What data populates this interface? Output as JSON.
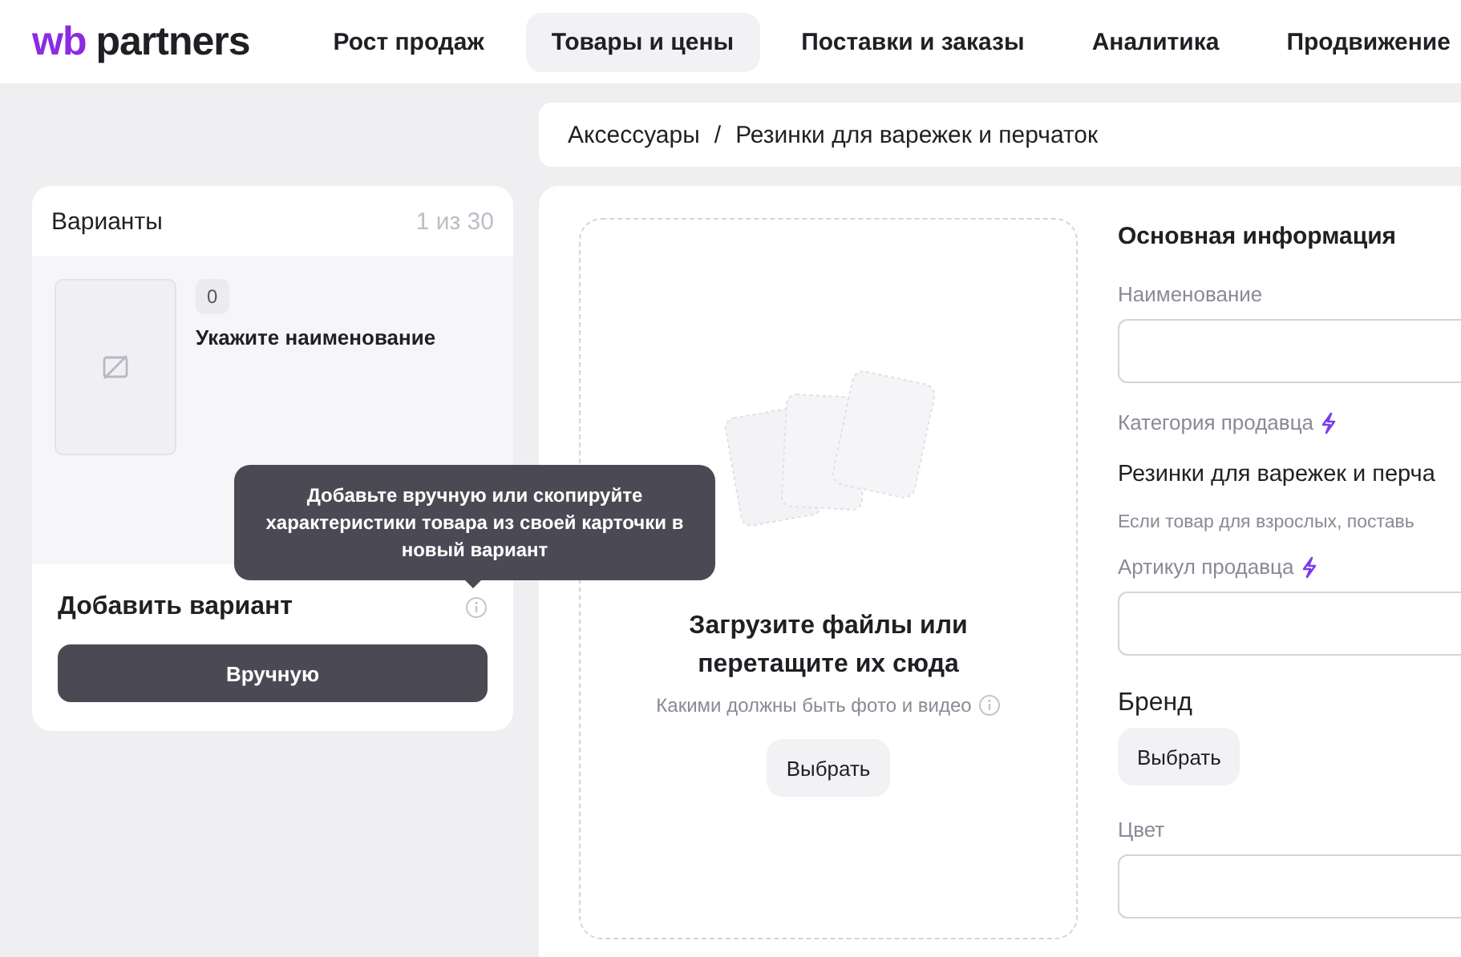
{
  "logo": {
    "mark": "wb",
    "name": "partners"
  },
  "nav": [
    {
      "label": "Рост продаж",
      "selected": false
    },
    {
      "label": "Товары и цены",
      "selected": true
    },
    {
      "label": "Поставки и заказы",
      "selected": false
    },
    {
      "label": "Аналитика",
      "selected": false
    },
    {
      "label": "Продвижение",
      "selected": false
    }
  ],
  "breadcrumb": [
    "Аксессуары",
    "Резинки для варежек и перчаток"
  ],
  "breadcrumb_separator": "/",
  "variants": {
    "title": "Варианты",
    "counter": "1 из 30",
    "items": [
      {
        "badge": "0",
        "name": "Укажите наименование"
      }
    ],
    "add_title": "Добавить вариант",
    "add_button": "Вручную",
    "tooltip": "Добавьте вручную или скопируйте характеристики товара из своей карточки в новый вариант"
  },
  "upload": {
    "title": "Загрузите файлы или перетащите их сюда",
    "hint": "Какими должны быть фото и видео",
    "button": "Выбрать"
  },
  "form": {
    "title": "Основная информация",
    "fields": [
      {
        "kind": "input",
        "label": "Наименование",
        "lightning": false
      },
      {
        "kind": "value",
        "label": "Категория продавца",
        "lightning": true,
        "value": "Резинки для варежек и перча",
        "note": "Если товар для взрослых, поставь"
      },
      {
        "kind": "input",
        "label": "Артикул продавца",
        "lightning": true
      },
      {
        "kind": "button",
        "label": "Бренд",
        "button": "Выбрать"
      },
      {
        "kind": "input",
        "label": "Цвет",
        "lightning": false
      }
    ]
  }
}
